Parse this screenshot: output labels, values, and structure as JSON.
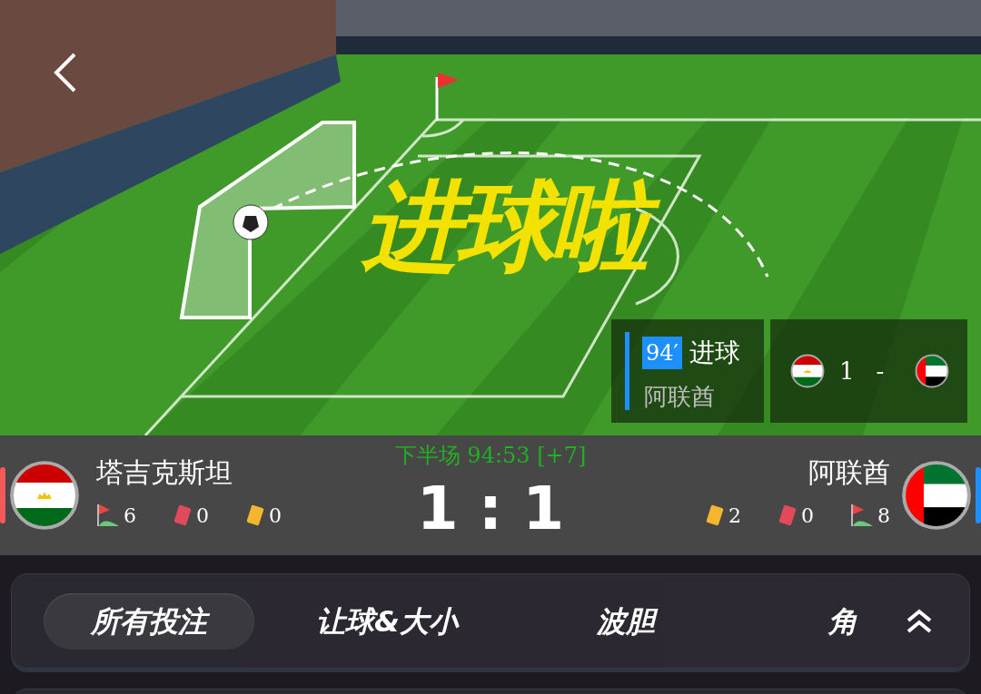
{
  "animation": {
    "headline": "进球啦",
    "event": {
      "minute": "94′",
      "title": "进球",
      "team": "阿联酋"
    },
    "mini_score": {
      "home_score": "1",
      "separator": "-"
    }
  },
  "match": {
    "period": "下半场 94:53 [+7]",
    "score_home": "1",
    "score_separator": ":",
    "score_away": "1",
    "home": {
      "name": "塔吉克斯坦",
      "color": "#f25a5a",
      "stats": [
        {
          "kind": "corner",
          "value": "6"
        },
        {
          "kind": "red",
          "value": "0"
        },
        {
          "kind": "yellow",
          "value": "0"
        }
      ]
    },
    "away": {
      "name": "阿联酋",
      "color": "#1e8fff",
      "stats": [
        {
          "kind": "yellow",
          "value": "2"
        },
        {
          "kind": "red",
          "value": "0"
        },
        {
          "kind": "corner",
          "value": "8"
        }
      ]
    }
  },
  "tabs": [
    {
      "label": "所有投注",
      "selected": true
    },
    {
      "label": "让球&大小",
      "selected": false
    },
    {
      "label": "波胆",
      "selected": false
    },
    {
      "label": "角",
      "selected": false
    }
  ]
}
